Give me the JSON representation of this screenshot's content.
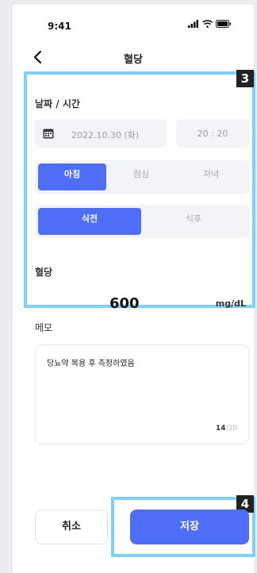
{
  "status_bar": {
    "time": "9:41"
  },
  "nav": {
    "title": "혈당"
  },
  "annotations": {
    "box_3": "3",
    "box_4": "4"
  },
  "datetime": {
    "label": "날짜 / 시간",
    "date": "2022.10.30 (화)",
    "time": "20 : 20"
  },
  "meal_segment": {
    "options": [
      "아침",
      "점심",
      "저녁"
    ],
    "selected": "아침"
  },
  "timing_segment": {
    "options": [
      "식전",
      "식후"
    ],
    "selected": "식전"
  },
  "glucose": {
    "label": "혈당",
    "value": "600",
    "unit": "mg/dL"
  },
  "memo": {
    "label": "메모",
    "text": "당뇨약 복용 후 측정하였음",
    "count_current": "14",
    "count_max": "/30"
  },
  "buttons": {
    "cancel": "취소",
    "save": "저장"
  },
  "colors": {
    "primary": "#4f6ef7",
    "highlight": "#7dd3f5"
  },
  "icons": [
    "back-icon",
    "calendar-icon",
    "signal-icon",
    "wifi-icon",
    "battery-icon"
  ]
}
